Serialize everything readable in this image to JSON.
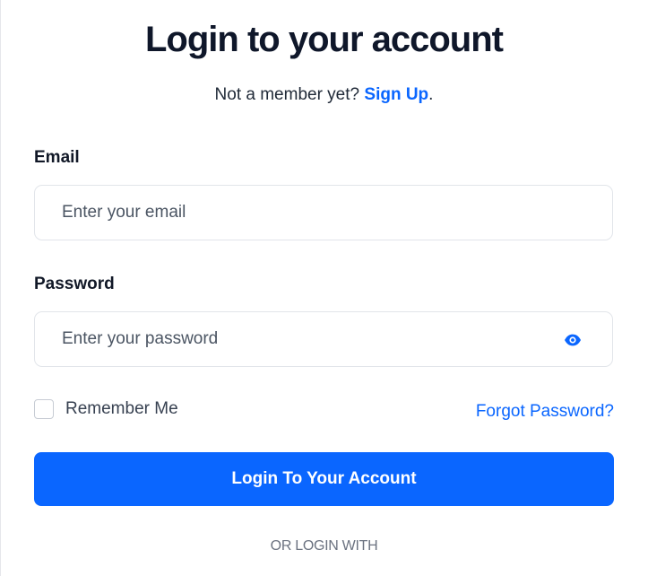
{
  "header": {
    "title": "Login to your account",
    "prompt_text": "Not a member yet?",
    "signup_link": "Sign Up",
    "prompt_suffix": "."
  },
  "form": {
    "email": {
      "label": "Email",
      "placeholder": "Enter your email",
      "value": ""
    },
    "password": {
      "label": "Password",
      "placeholder": "Enter your password",
      "value": "",
      "toggle_icon": "eye-icon"
    },
    "remember_me": {
      "label": "Remember Me",
      "checked": false
    },
    "forgot_password_link": "Forgot Password?",
    "submit_label": "Login To Your Account"
  },
  "footer": {
    "divider_text": "OR LOGIN WITH"
  },
  "colors": {
    "accent": "#0a66ff",
    "title": "#0f172a",
    "border": "#e2e5ea"
  }
}
